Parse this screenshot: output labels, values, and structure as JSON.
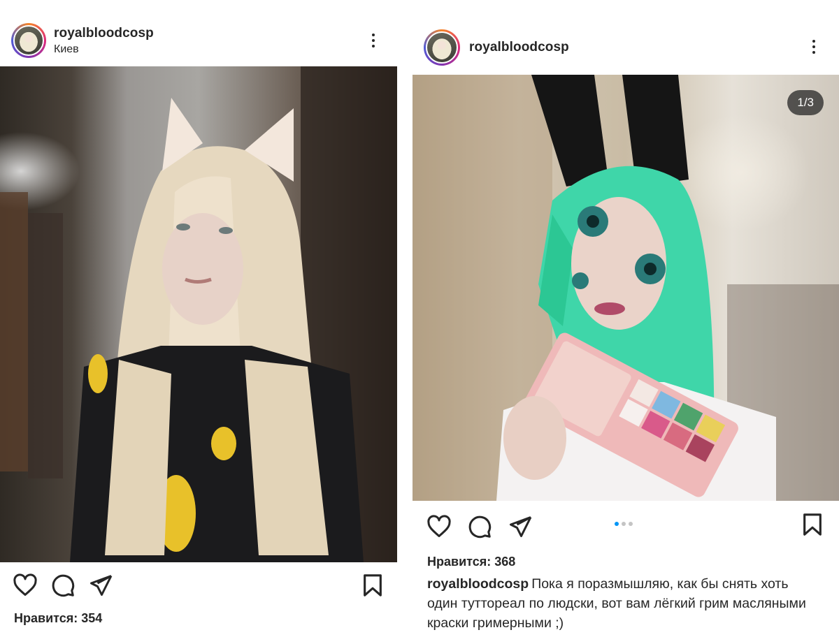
{
  "left_post": {
    "username": "royalbloodcosp",
    "location": "Киев",
    "likes": "Нравится: 354",
    "icons": {
      "avatar": "profile-avatar",
      "more": "more-vertical-icon",
      "like": "heart-icon",
      "comment": "comment-icon",
      "share": "send-icon",
      "save": "bookmark-icon"
    }
  },
  "right_post": {
    "username": "royalbloodcosp",
    "image_counter": "1/3",
    "carousel": {
      "count": 3,
      "active_index": 0
    },
    "likes": "Нравится: 368",
    "caption_user": "royalbloodcosp",
    "caption_text": "Пока я поразмышляю, как бы снять хоть один туттореал по людски, вот вам лёгкий грим масляными краски гримерными ;)",
    "icons": {
      "avatar": "profile-avatar",
      "more": "more-vertical-icon",
      "like": "heart-icon",
      "comment": "comment-icon",
      "share": "send-icon",
      "save": "bookmark-icon"
    }
  },
  "colors": {
    "text": "#262626",
    "active_dot": "#0095f6",
    "inactive_dot": "#c4c4c4",
    "badge_bg": "#262626"
  }
}
